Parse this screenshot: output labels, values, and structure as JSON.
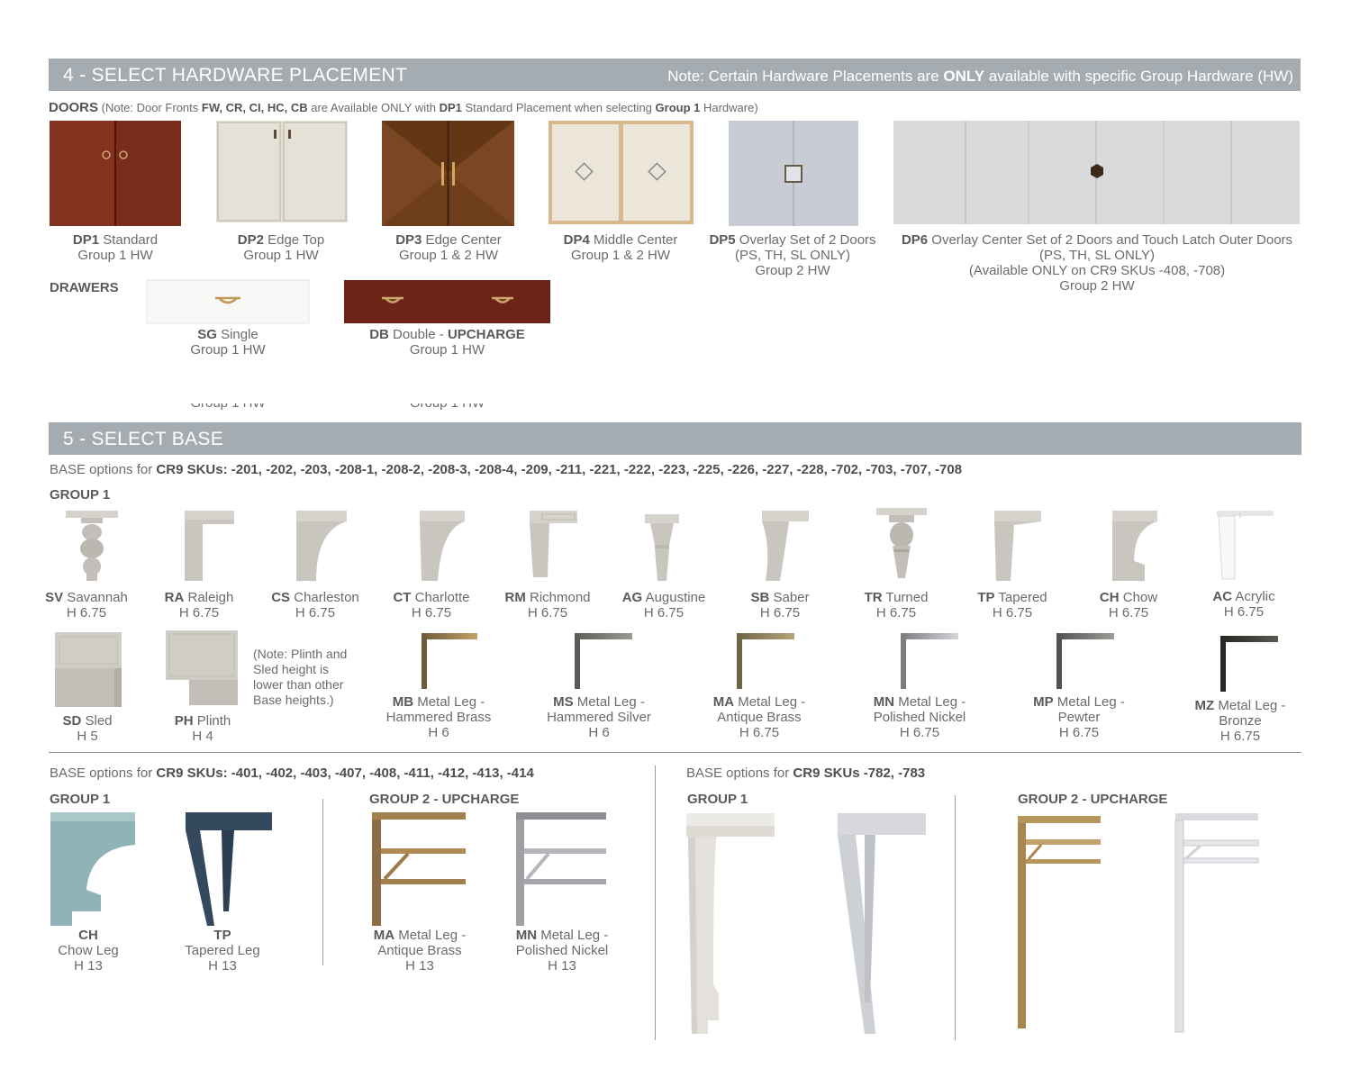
{
  "section4": {
    "title": "4 - SELECT HARDWARE PLACEMENT",
    "note_prefix": "Note: Certain Hardware Placements are ",
    "note_bold": "ONLY",
    "note_suffix": " available with specific Group Hardware (HW)"
  },
  "doors": {
    "heading": "DOORS",
    "note": [
      {
        "t": " (Note: Door Fronts ",
        "b": false
      },
      {
        "t": "FW, CR, CI, HC, CB",
        "b": true
      },
      {
        "t": " are Available ONLY with ",
        "b": false
      },
      {
        "t": "DP1",
        "b": true
      },
      {
        "t": " Standard Placement when selecting ",
        "b": false
      },
      {
        "t": "Group 1",
        "b": true
      },
      {
        "t": " Hardware)",
        "b": false
      }
    ],
    "items": [
      {
        "code": "DP1",
        "name": " Standard",
        "lines": [
          "Group 1 HW"
        ]
      },
      {
        "code": "DP2",
        "name": " Edge Top",
        "lines": [
          "Group 1 HW"
        ]
      },
      {
        "code": "DP3",
        "name": " Edge Center",
        "lines": [
          "Group 1 & 2 HW"
        ]
      },
      {
        "code": "DP4",
        "name": " Middle Center",
        "lines": [
          "Group 1 & 2 HW"
        ]
      },
      {
        "code": "DP5",
        "name": " Overlay Set of 2 Doors",
        "lines": [
          "(PS, TH, SL ONLY)",
          "Group 2 HW"
        ]
      },
      {
        "code": "DP6",
        "name": " Overlay Center Set of 2 Doors and Touch Latch Outer Doors",
        "lines": [
          "(PS, TH, SL ONLY)",
          "(Available ONLY on CR9 SKUs -408, -708)",
          "Group 2 HW"
        ]
      }
    ]
  },
  "drawers": {
    "heading": "DRAWERS",
    "items": [
      {
        "code": "SG",
        "name": " Single",
        "sub": "Group 1 HW"
      },
      {
        "code": "DB",
        "name": " Double - ",
        "upcharge": "UPCHARGE",
        "sub": "Group 1 HW"
      }
    ]
  },
  "section5": {
    "title": "5 - SELECT BASE"
  },
  "base_options_1": {
    "prefix": "BASE options for ",
    "skus_bold": "CR9 SKUs",
    "skus_list": ": -201, -202, -203, -208-1, -208-2, -208-3, -208-4, -209, -211, -221, -222, -223, -225, -226, -227, -228, -702, -703, -707, -708",
    "group1": "GROUP 1",
    "legs": [
      {
        "code": "SV",
        "name": " Savannah",
        "h": "H 6.75"
      },
      {
        "code": "RA",
        "name": " Raleigh",
        "h": "H 6.75"
      },
      {
        "code": "CS",
        "name": " Charleston",
        "h": "H 6.75"
      },
      {
        "code": "CT",
        "name": " Charlotte",
        "h": "H 6.75"
      },
      {
        "code": "RM",
        "name": " Richmond",
        "h": "H 6.75"
      },
      {
        "code": "AG",
        "name": " Augustine",
        "h": "H 6.75"
      },
      {
        "code": "SB",
        "name": " Saber",
        "h": "H 6.75"
      },
      {
        "code": "TR",
        "name": " Turned",
        "h": "H 6.75"
      },
      {
        "code": "TP",
        "name": " Tapered",
        "h": "H 6.75"
      },
      {
        "code": "CH",
        "name": " Chow",
        "h": "H 6.75"
      },
      {
        "code": "AC",
        "name": " Acrylic",
        "h": "H 6.75"
      }
    ],
    "row2": [
      {
        "code": "SD",
        "name": " Sled",
        "h": "H 5"
      },
      {
        "code": "PH",
        "name": " Plinth",
        "h": "H 4"
      }
    ],
    "plinth_note": [
      "(Note: Plinth and",
      "Sled height is",
      "lower than other",
      "Base heights.)"
    ],
    "metal": [
      {
        "code": "MB",
        "name": " Metal Leg -",
        "finish": "Hammered Brass",
        "h": "H 6"
      },
      {
        "code": "MS",
        "name": " Metal Leg -",
        "finish": "Hammered Silver",
        "h": "H 6"
      },
      {
        "code": "MA",
        "name": " Metal Leg -",
        "finish": "Antique Brass",
        "h": "H 6.75"
      },
      {
        "code": "MN",
        "name": " Metal Leg -",
        "finish": "Polished Nickel",
        "h": "H 6.75"
      },
      {
        "code": "MP",
        "name": " Metal Leg -",
        "finish": "Pewter",
        "h": "H 6.75"
      },
      {
        "code": "MZ",
        "name": " Metal Leg -",
        "finish": "Bronze",
        "h": "H 6.75"
      }
    ]
  },
  "base_options_2": {
    "prefix": "BASE options for ",
    "skus_bold": "CR9 SKUs: -401, -402, -403, -407, -408, -411, -412, -413, -414",
    "group1": "GROUP 1",
    "group2": "GROUP 2 - UPCHARGE",
    "g1": [
      {
        "code": "CH",
        "name": "Chow Leg",
        "h": "H 13"
      },
      {
        "code": "TP",
        "name": "Tapered  Leg",
        "h": "H 13"
      }
    ],
    "g2": [
      {
        "code": "MA",
        "name": " Metal Leg -",
        "finish": "Antique Brass",
        "h": "H 13"
      },
      {
        "code": "MN",
        "name": " Metal Leg -",
        "finish": "Polished Nickel",
        "h": "H 13"
      }
    ]
  },
  "base_options_3": {
    "prefix": "BASE options for ",
    "skus_bold": "CR9 SKUs -782, -783",
    "group1": "GROUP 1",
    "group2": "GROUP 2 - UPCHARGE"
  },
  "colors": {
    "bar": "#a5acb1",
    "cherry": "#7a2c1a",
    "linen": "#e6e1d6",
    "walnut": "#6e3e1c",
    "grey_leg": "#cfccc6",
    "blue_chow": "#8fb3b6",
    "navy_tp": "#34485e",
    "brass": "#b08a55"
  }
}
